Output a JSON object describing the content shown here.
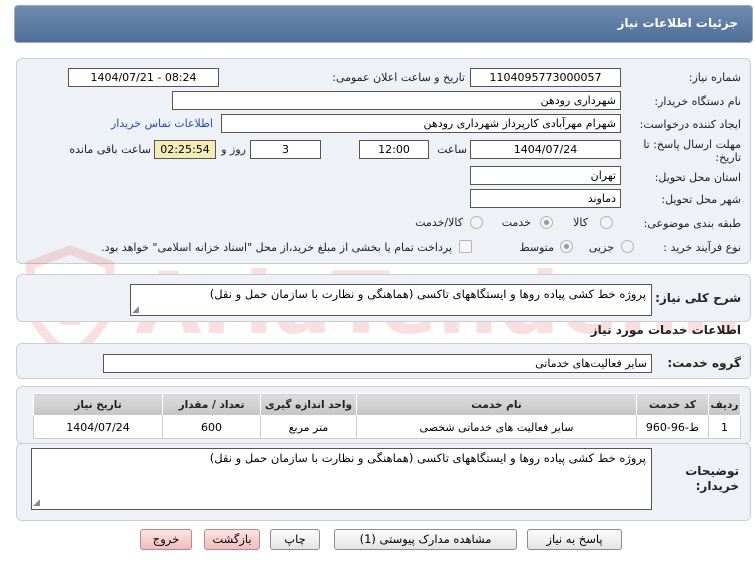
{
  "header": {
    "title": "جزئیات اطلاعات نیاز"
  },
  "form": {
    "need_number_label": "شماره نیاز:",
    "need_number": "1104095773000057",
    "announce_label": "تاریخ و ساعت اعلان عمومی:",
    "announce_value": "1404/07/21 - 08:24",
    "buyer_label": "نام دستگاه خریدار:",
    "buyer_value": "شهرداری رودهن",
    "creator_label": "ایجاد کننده درخواست:",
    "creator_value": "شهرام مهرآبادی کارپرداز شهرداری رودهن",
    "contact_link": "اطلاعات تماس خریدار",
    "deadline_label": "مهلت ارسال پاسخ: تا تاریخ:",
    "deadline_date": "1404/07/24",
    "time_label": "ساعت",
    "deadline_time": "12:00",
    "days_value": "3",
    "days_label": "روز و",
    "remaining_value": "02:25:54",
    "remaining_label": "ساعت باقی مانده",
    "province_label": "استان محل تحویل:",
    "province_value": "تهران",
    "city_label": "شهر محل تحویل:",
    "city_value": "دماوند",
    "category_label": "طبقه بندی موضوعی:",
    "category_options": [
      "کالا",
      "خدمت",
      "کالا/خدمت"
    ],
    "category_selected": "خدمت",
    "process_label": "نوع فرآیند خرید :",
    "process_options": [
      "جزیی",
      "متوسط"
    ],
    "process_selected": "متوسط",
    "payment_note": "پرداخت تمام یا بخشی از مبلغ خرید،از محل \"اسناد خزانه اسلامی\" خواهد بود."
  },
  "description": {
    "label": "شرح کلی نیاز:",
    "value": "پروژه خط کشی پیاده روها و ایستگاههای تاکسی (هماهنگی و نظارت با سازمان حمل و نقل)"
  },
  "services": {
    "section_title": "اطلاعات خدمات مورد نیاز",
    "group_label": "گروه خدمت:",
    "group_value": "سایر فعالیت‌های خدماتی",
    "columns": [
      "ردیف",
      "کد خدمت",
      "نام خدمت",
      "واحد اندازه گیری",
      "تعداد / مقدار",
      "تاریخ نیاز"
    ],
    "rows": [
      [
        "1",
        "ط-96-960",
        "سایر فعالیت های خدماتی شخصی",
        "متر مربع",
        "600",
        "1404/07/24"
      ]
    ]
  },
  "buyer_notes": {
    "label": "توضیحات خریدار:",
    "value": "پروژه خط کشی پیاده روها و ایستگاههای تاکسی (هماهنگی و نظارت با سازمان حمل و نقل)"
  },
  "buttons": {
    "reply": "پاسخ به نیاز",
    "attachments": "مشاهده مدارک پیوستی (1)",
    "print": "چاپ",
    "back": "بازگشت",
    "exit": "خروج"
  },
  "watermark": {
    "text": "AriaTender.net"
  },
  "colors": {
    "header": "#5b7aa3",
    "panel": "#eef1f6",
    "yellow_field": "#f5ecb3",
    "exit_button": "#f2bcbc"
  }
}
